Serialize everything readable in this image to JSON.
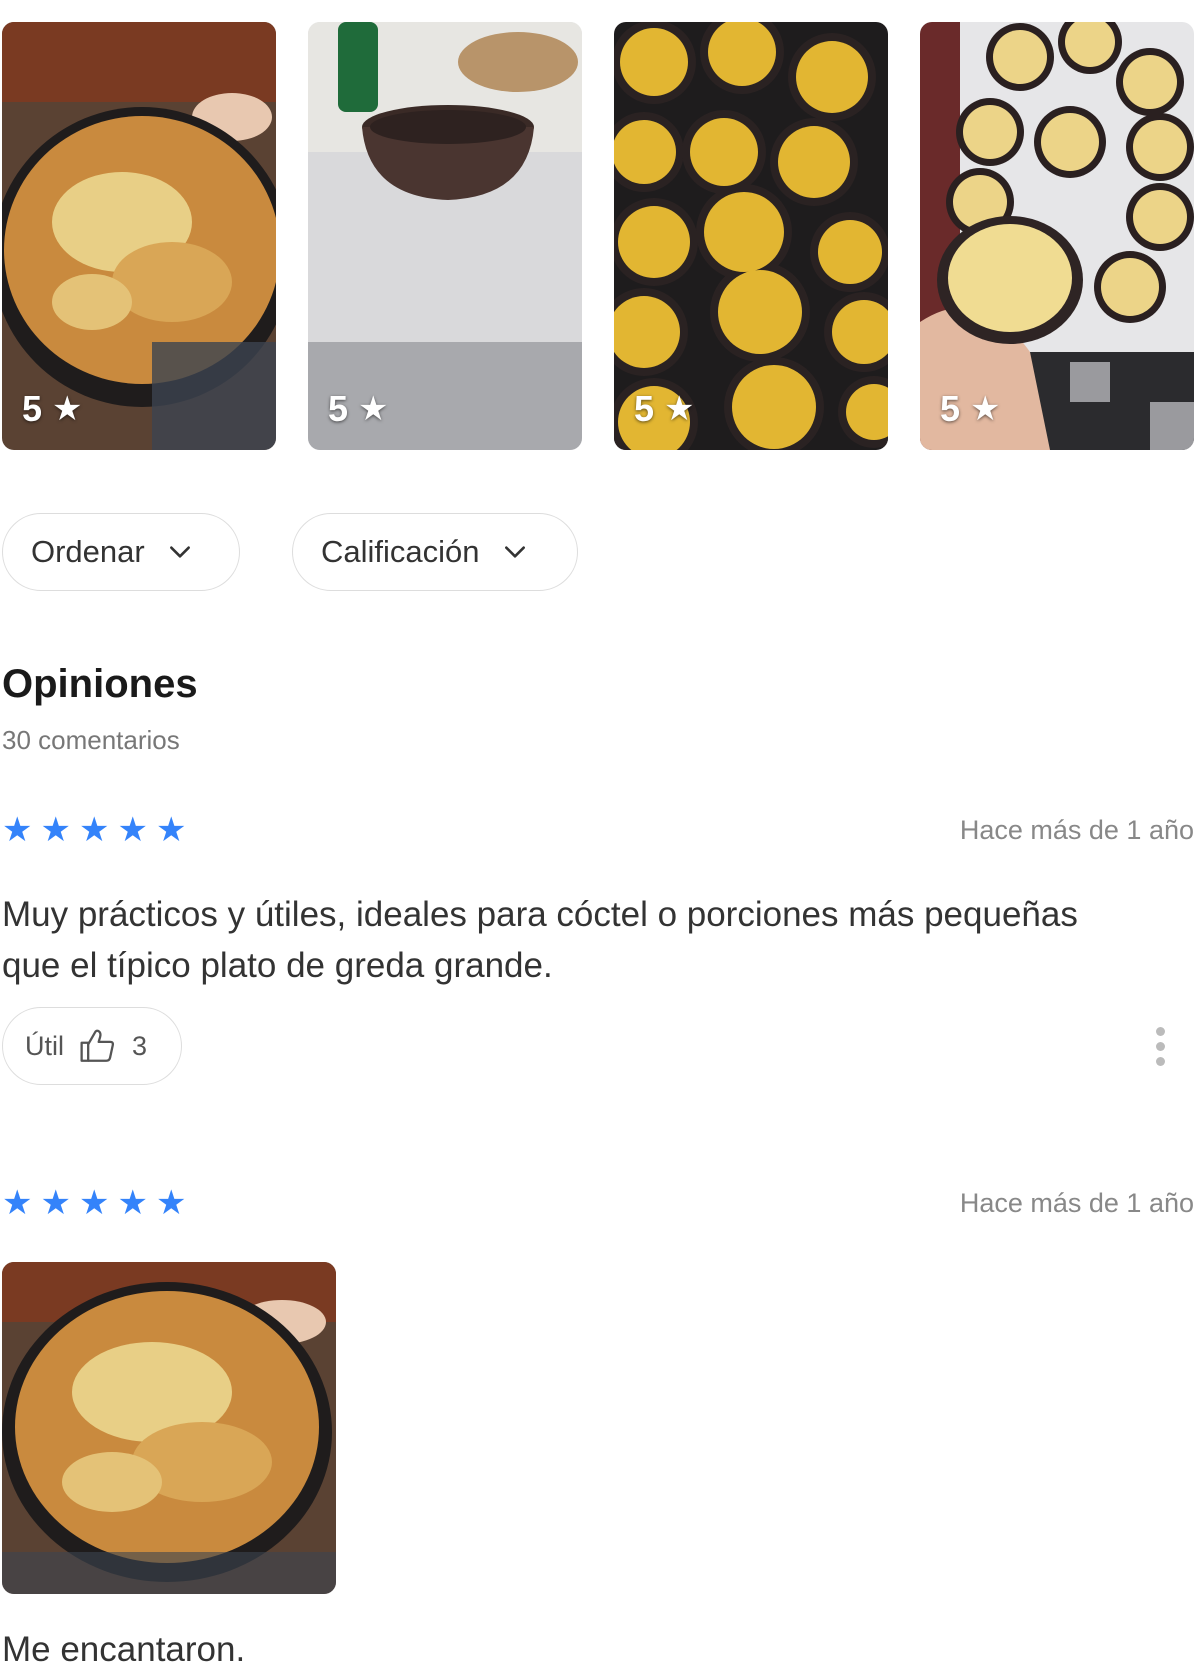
{
  "gallery": {
    "photos": [
      {
        "rating": "5",
        "icon": "star-icon",
        "subject": "pastel-in-clay-bowl"
      },
      {
        "rating": "5",
        "icon": "star-icon",
        "subject": "empty-clay-bowl"
      },
      {
        "rating": "5",
        "icon": "star-icon",
        "subject": "tray-of-pasteles"
      },
      {
        "rating": "5",
        "icon": "star-icon",
        "subject": "hand-holding-pastel"
      }
    ]
  },
  "filters": {
    "sort_label": "Ordenar",
    "rating_label": "Calificación"
  },
  "opinions": {
    "title": "Opiniones",
    "count_label": "30 comentarios"
  },
  "reviews": [
    {
      "stars": 5,
      "date": "Hace más de 1 año",
      "text": "Muy prácticos y útiles, ideales para cóctel o porciones más pequeñas que el típico plato de greda grande.",
      "helpful_label": "Útil",
      "helpful_count": "3"
    },
    {
      "stars": 5,
      "date": "Hace más de 1 año",
      "text": "Me encantaron."
    }
  ],
  "colors": {
    "star_blue": "#3483fa",
    "border": "#dddddd",
    "muted_text": "#888888"
  }
}
